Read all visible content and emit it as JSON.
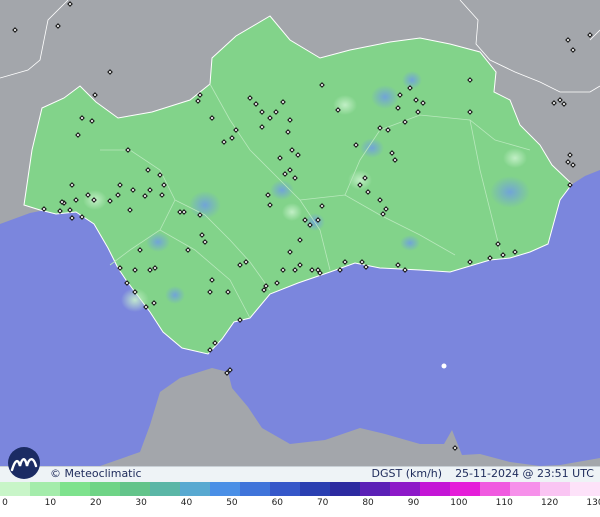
{
  "brand": {
    "name": "Meteoclimatic"
  },
  "caption": {
    "variable": "DGST (km/h)",
    "datetime": "25-11-2024 @ 23:51 UTC"
  },
  "legend": {
    "ticks": [
      "0",
      "10",
      "20",
      "30",
      "40",
      "50",
      "60",
      "70",
      "80",
      "90",
      "100",
      "110",
      "120",
      "130"
    ],
    "gradient_colors": [
      "#c8f5c8",
      "#a4ecab",
      "#7ee28d",
      "#6fd486",
      "#63c48a",
      "#5ab6a6",
      "#58a9d1",
      "#4a8fe6",
      "#3f74da",
      "#3557c9",
      "#2a3fb1",
      "#2c2aa0",
      "#5b20b6",
      "#8d19c8",
      "#c415d6",
      "#e51ed9",
      "#f05ae0",
      "#f690ea",
      "#fac5f3",
      "#fde2f9"
    ]
  },
  "colors": {
    "sea": "#7b86dd",
    "land_region": "#82d38a",
    "land_other": "#a3a6ab",
    "station_marker": "#111111"
  }
}
